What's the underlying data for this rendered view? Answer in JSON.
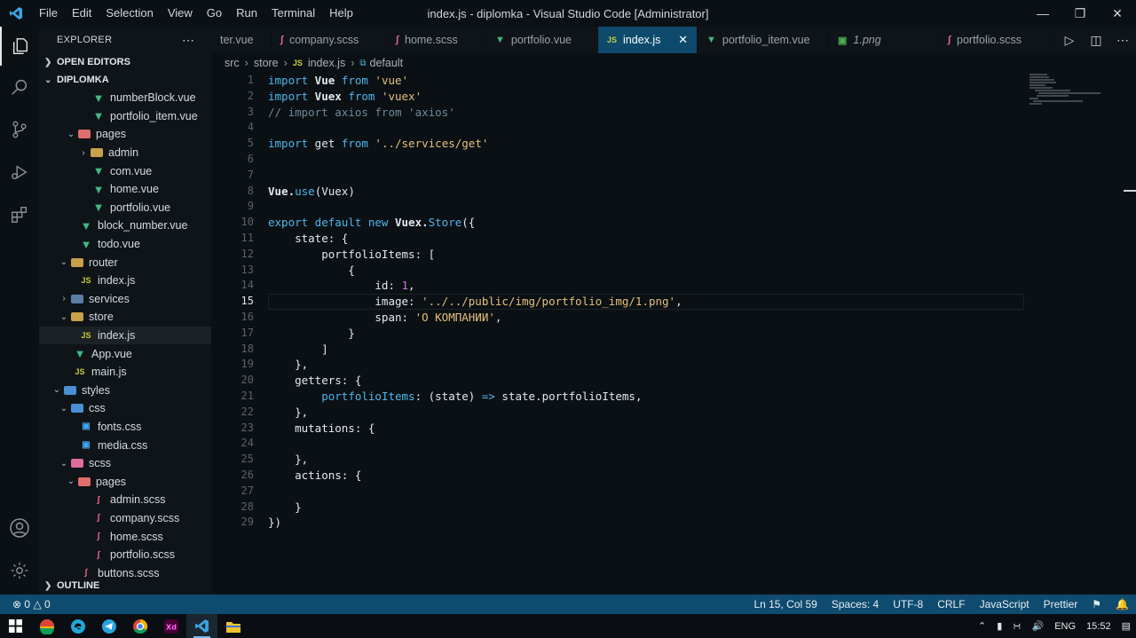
{
  "window": {
    "menu": [
      "File",
      "Edit",
      "Selection",
      "View",
      "Go",
      "Run",
      "Terminal",
      "Help"
    ],
    "title": "index.js - diplomka - Visual Studio Code [Administrator]"
  },
  "sidebar": {
    "title": "EXPLORER",
    "open_editors": "OPEN EDITORS",
    "project": "DIPLOMKA",
    "outline": "OUTLINE",
    "items": [
      {
        "label": "numberBlock.vue",
        "type": "vue"
      },
      {
        "label": "portfolio_item.vue",
        "type": "vue"
      },
      {
        "label": "pages",
        "type": "folder-open"
      },
      {
        "label": "admin",
        "type": "folder"
      },
      {
        "label": "com.vue",
        "type": "vue"
      },
      {
        "label": "home.vue",
        "type": "vue"
      },
      {
        "label": "portfolio.vue",
        "type": "vue"
      },
      {
        "label": "block_number.vue",
        "type": "vue"
      },
      {
        "label": "todo.vue",
        "type": "vue"
      },
      {
        "label": "router",
        "type": "folder-open"
      },
      {
        "label": "index.js",
        "type": "js"
      },
      {
        "label": "services",
        "type": "folder"
      },
      {
        "label": "store",
        "type": "folder-open"
      },
      {
        "label": "index.js",
        "type": "js"
      },
      {
        "label": "App.vue",
        "type": "vue"
      },
      {
        "label": "main.js",
        "type": "js"
      },
      {
        "label": "styles",
        "type": "folder-open"
      },
      {
        "label": "css",
        "type": "folder-open"
      },
      {
        "label": "fonts.css",
        "type": "css"
      },
      {
        "label": "media.css",
        "type": "css"
      },
      {
        "label": "scss",
        "type": "folder-open"
      },
      {
        "label": "pages",
        "type": "folder-open"
      },
      {
        "label": "admin.scss",
        "type": "scss"
      },
      {
        "label": "company.scss",
        "type": "scss"
      },
      {
        "label": "home.scss",
        "type": "scss"
      },
      {
        "label": "portfolio.scss",
        "type": "scss"
      },
      {
        "label": "buttons.scss",
        "type": "scss"
      }
    ]
  },
  "tabs": [
    {
      "label": "ter.vue",
      "type": "vue"
    },
    {
      "label": "company.scss",
      "type": "scss"
    },
    {
      "label": "home.scss",
      "type": "scss"
    },
    {
      "label": "portfolio.vue",
      "type": "vue"
    },
    {
      "label": "index.js",
      "type": "js",
      "active": true
    },
    {
      "label": "portfolio_item.vue",
      "type": "vue"
    },
    {
      "label": "1.png",
      "type": "image"
    },
    {
      "label": "portfolio.scss",
      "type": "scss"
    }
  ],
  "breadcrumb": {
    "src": "src",
    "store": "store",
    "file": "index.js",
    "symbol": "default"
  },
  "editor": {
    "current_line": 15,
    "line_numbers": [
      "1",
      "2",
      "3",
      "4",
      "5",
      "6",
      "7",
      "8",
      "9",
      "10",
      "11",
      "12",
      "13",
      "14",
      "15",
      "16",
      "17",
      "18",
      "19",
      "20",
      "21",
      "22",
      "23",
      "24",
      "25",
      "26",
      "27",
      "28",
      "29"
    ],
    "code": {
      "l1_kw": "import",
      "l1_id": " Vue ",
      "l1_from": "from",
      "l1_str": " 'vue'",
      "l2_kw": "import",
      "l2_id": " Vuex ",
      "l2_from": "from",
      "l2_str": " 'vuex'",
      "l3_cm": "// import axios from 'axios'",
      "l5_kw": "import",
      "l5_id": " get ",
      "l5_from": "from",
      "l5_str": " '../services/get'",
      "l8_a": "Vue.",
      "l8_fn": "use",
      "l8_b": "(Vuex)",
      "l10_kw": "export default new",
      "l10_a": " Vuex.",
      "l10_fn": "Store",
      "l10_b": "({",
      "l11": "    state: {",
      "l12": "        portfolioItems: [",
      "l13": "            {",
      "l14_a": "                id: ",
      "l14_num": "1",
      "l14_b": ",",
      "l15_a": "                image: ",
      "l15_str": "'../../public/img/portfolio_img/1.png'",
      "l15_b": ",",
      "l16_a": "                span: ",
      "l16_str": "'О КОМПАНИИ'",
      "l16_b": ",",
      "l17": "            }",
      "l18": "        ]",
      "l19": "    },",
      "l20": "    getters: {",
      "l21_a": "        ",
      "l21_fn": "portfolioItems",
      "l21_b": ": (state) ",
      "l21_arrow": "=>",
      "l21_c": " state.portfolioItems,",
      "l22": "    },",
      "l23": "    mutations: {",
      "l24": "",
      "l25": "    },",
      "l26": "    actions: {",
      "l27": "",
      "l28": "    }",
      "l29": "})"
    }
  },
  "status": {
    "errors": "0",
    "warnings": "0",
    "position": "Ln 15, Col 59",
    "spaces": "Spaces: 4",
    "encoding": "UTF-8",
    "eol": "CRLF",
    "language": "JavaScript",
    "formatter": "Prettier"
  },
  "tray": {
    "lang": "ENG",
    "time": "15:52"
  }
}
